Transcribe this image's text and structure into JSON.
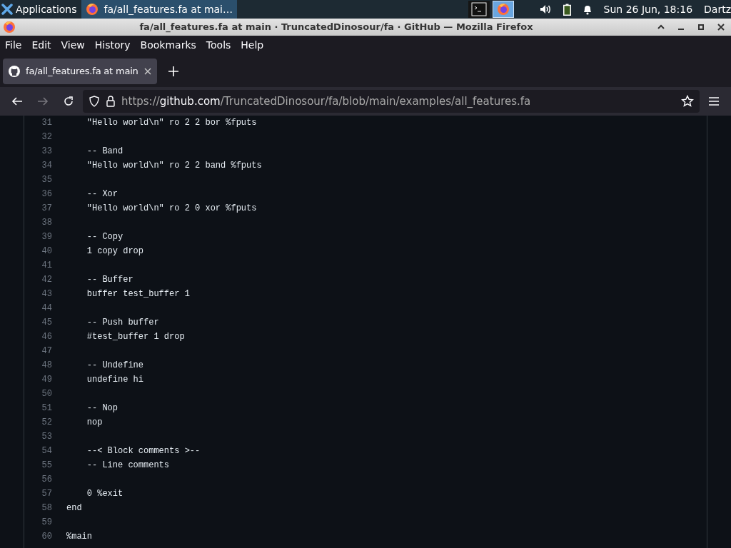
{
  "taskbar": {
    "menu_label": "Applications",
    "windows": [
      {
        "label": "fa/all_features.fa at mai…",
        "selected": true
      }
    ],
    "launchers": [
      {
        "kind": "terminal",
        "selected": false
      },
      {
        "kind": "firefox",
        "selected": true
      }
    ],
    "clock": "Sun 26 Jun, 18:16",
    "user": "Dartz"
  },
  "window": {
    "title": "fa/all_features.fa at main · TruncatedDinosour/fa · GitHub — Mozilla Firefox"
  },
  "menu": [
    {
      "label": "File"
    },
    {
      "label": "Edit"
    },
    {
      "label": "View"
    },
    {
      "label": "History"
    },
    {
      "label": "Bookmarks"
    },
    {
      "label": "Tools"
    },
    {
      "label": "Help"
    }
  ],
  "tabs": [
    {
      "label": "fa/all_features.fa at main",
      "selected": true
    }
  ],
  "address": {
    "scheme": "https://",
    "host": "github.com",
    "path": "/TruncatedDinosour/fa/blob/main/examples/all_features.fa"
  },
  "code": [
    {
      "n": "31",
      "text": "    \"Hello world\\n\" ro 2 2 bor %fputs"
    },
    {
      "n": "32"
    },
    {
      "n": "33",
      "text": "    -- Band"
    },
    {
      "n": "34",
      "text": "    \"Hello world\\n\" ro 2 2 band %fputs"
    },
    {
      "n": "35"
    },
    {
      "n": "36",
      "text": "    -- Xor"
    },
    {
      "n": "37",
      "text": "    \"Hello world\\n\" ro 2 0 xor %fputs"
    },
    {
      "n": "38"
    },
    {
      "n": "39",
      "text": "    -- Copy"
    },
    {
      "n": "40",
      "text": "    1 copy drop"
    },
    {
      "n": "41"
    },
    {
      "n": "42",
      "text": "    -- Buffer"
    },
    {
      "n": "43",
      "text": "    buffer test_buffer 1"
    },
    {
      "n": "44"
    },
    {
      "n": "45",
      "text": "    -- Push buffer"
    },
    {
      "n": "46",
      "text": "    #test_buffer 1 drop"
    },
    {
      "n": "47"
    },
    {
      "n": "48",
      "text": "    -- Undefine"
    },
    {
      "n": "49",
      "text": "    undefine hi"
    },
    {
      "n": "50"
    },
    {
      "n": "51",
      "text": "    -- Nop"
    },
    {
      "n": "52",
      "text": "    nop"
    },
    {
      "n": "53"
    },
    {
      "n": "54",
      "text": "    --< Block comments >--"
    },
    {
      "n": "55",
      "text": "    -- Line comments"
    },
    {
      "n": "56"
    },
    {
      "n": "57",
      "text": "    0 %exit"
    },
    {
      "n": "58",
      "text": "end"
    },
    {
      "n": "59"
    },
    {
      "n": "60",
      "text": "%main"
    }
  ]
}
